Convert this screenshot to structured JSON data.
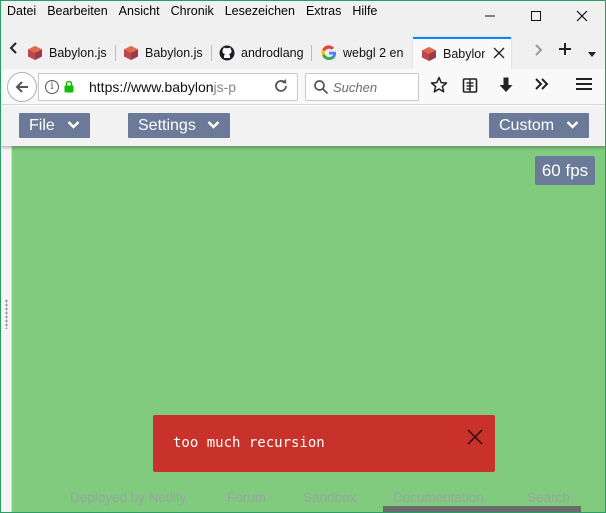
{
  "menu": {
    "items": [
      "Datei",
      "Bearbeiten",
      "Ansicht",
      "Chronik",
      "Lesezeichen",
      "Extras",
      "Hilfe"
    ]
  },
  "window_controls": {
    "minimize": "—",
    "maximize": "☐",
    "close": "✕"
  },
  "tabs": [
    {
      "title": "Babylon.js",
      "icon": "babylon-logo-icon",
      "active": false
    },
    {
      "title": "Babylon.js",
      "icon": "babylon-logo-icon",
      "active": false
    },
    {
      "title": "androdlang",
      "icon": "github-icon",
      "active": false
    },
    {
      "title": "webgl 2 en",
      "icon": "google-icon",
      "active": false
    },
    {
      "title": "Babylon",
      "icon": "babylon-logo-icon",
      "active": true
    }
  ],
  "navbar": {
    "url_host": "https://www.babylon",
    "url_rest": "js-p",
    "search_placeholder": "Suchen"
  },
  "playground": {
    "file_label": "File",
    "settings_label": "Settings",
    "custom_label": "Custom",
    "fps_label": "60 fps"
  },
  "error": {
    "message": "too much recursion"
  },
  "footer": {
    "links": [
      "Deployed by Netlify",
      "Forum",
      "Sandbox",
      "Documentation",
      "Search"
    ]
  },
  "colors": {
    "canvas_bg": "#80cb7e",
    "button_bg": "#6c7a99",
    "error_bg": "#c9322b",
    "accent_tab": "#0a84ff"
  }
}
